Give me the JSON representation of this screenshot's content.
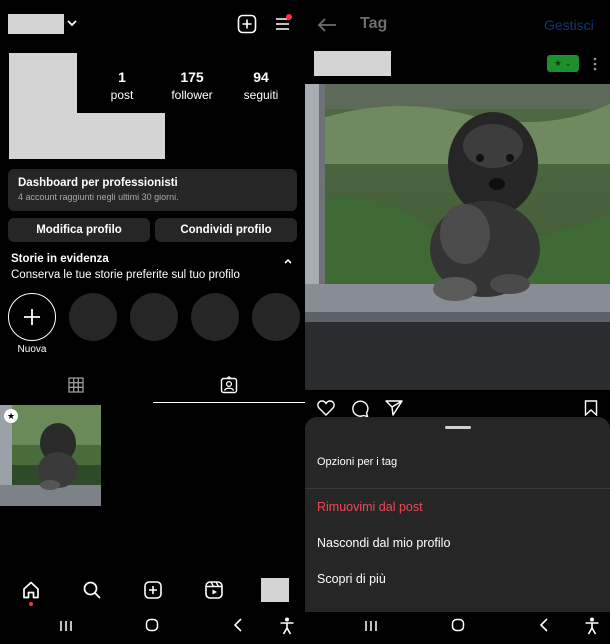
{
  "profile": {
    "stats": [
      {
        "value": "1",
        "label": "post"
      },
      {
        "value": "175",
        "label": "follower"
      },
      {
        "value": "94",
        "label": "seguiti"
      }
    ],
    "dashboard": {
      "title": "Dashboard per professionisti",
      "subtitle": "4 account raggiunti negli ultimi 30 giorni."
    },
    "buttons": {
      "edit": "Modifica profilo",
      "share": "Condividi profilo"
    },
    "highlights": {
      "title": "Storie in evidenza",
      "subtitle": "Conserva le tue storie preferite sul tuo profilo",
      "new_label": "Nuova"
    }
  },
  "post_view": {
    "back_icon": "arrow-left-icon",
    "title": "Tag",
    "manage": "Gestisci"
  },
  "tag_options": {
    "title": "Opzioni per i tag",
    "items": [
      {
        "label": "Rimuovimi dal post",
        "color": "#ed4956"
      },
      {
        "label": "Nascondi dal mio profilo",
        "color": "#ffffff"
      },
      {
        "label": "Scopri di più",
        "color": "#ffffff"
      }
    ]
  },
  "colors": {
    "background": "#000000",
    "surface": "#262626",
    "accent_blue": "#0095f6",
    "danger": "#ed4956",
    "notification_dot": "#ff3040",
    "badge_green": "#1f8f2e"
  }
}
